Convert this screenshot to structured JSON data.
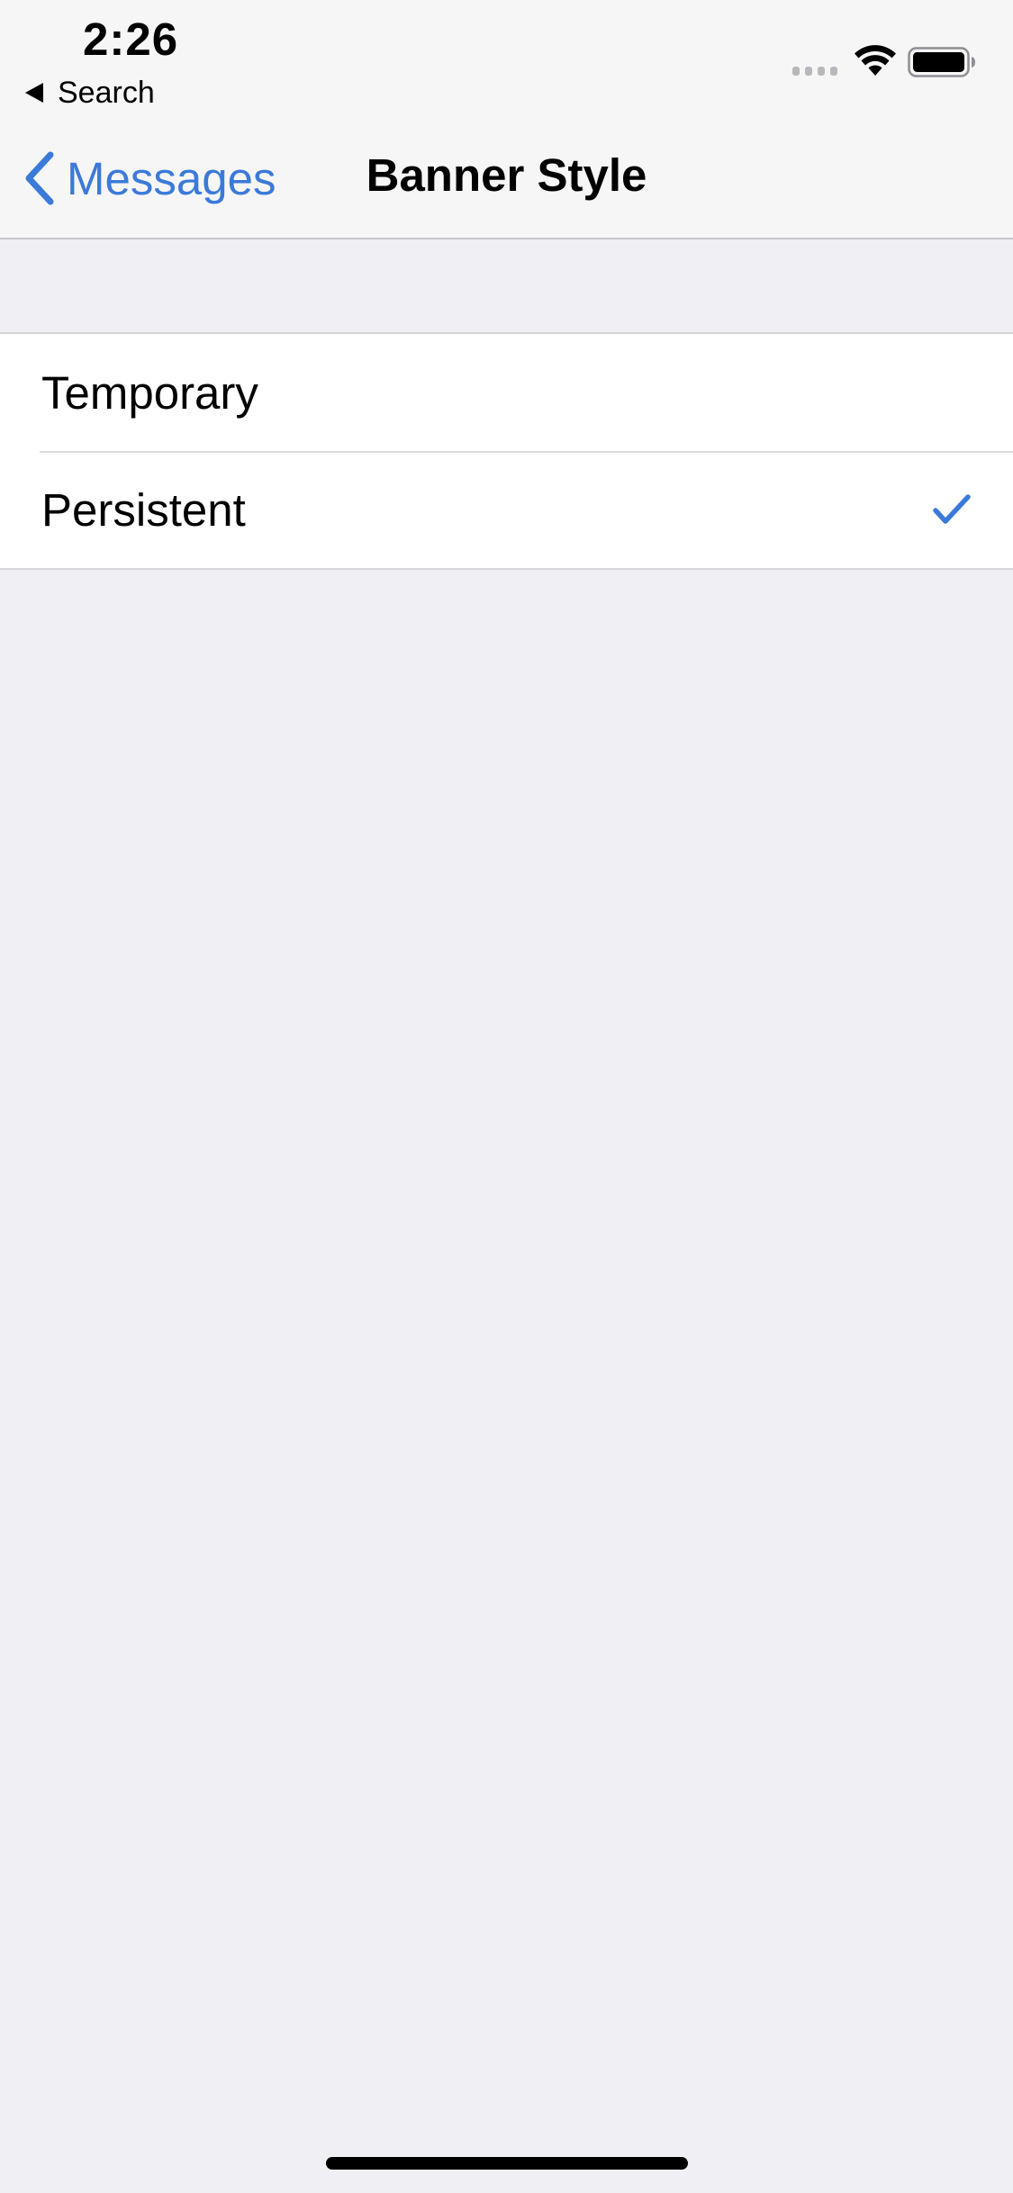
{
  "status_bar": {
    "time": "2:26",
    "back_app_label": "Search"
  },
  "nav": {
    "back_label": "Messages",
    "title": "Banner Style"
  },
  "options": [
    {
      "label": "Temporary",
      "selected": false
    },
    {
      "label": "Persistent",
      "selected": true
    }
  ],
  "colors": {
    "accent": "#3b7ad9",
    "background": "#efeff4",
    "cell": "#ffffff"
  },
  "icons": {
    "back": "chevron-left-icon",
    "check": "checkmark-icon",
    "wifi": "wifi-icon",
    "battery": "battery-icon"
  }
}
